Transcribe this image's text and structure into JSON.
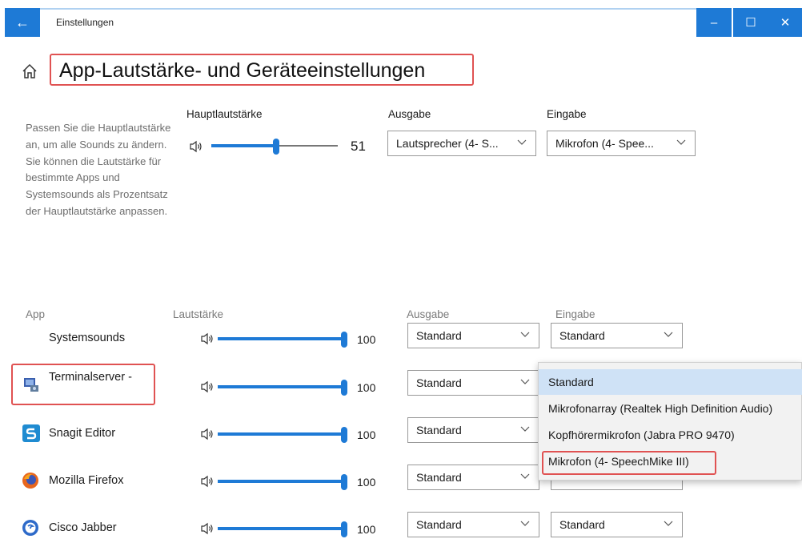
{
  "window": {
    "title": "Einstellungen",
    "back_glyph": "←",
    "minimize_glyph": "–",
    "maximize_glyph": "☐",
    "close_glyph": "✕",
    "accent": "#1e7ad6"
  },
  "page": {
    "title": "App-Lautstärke- und Geräteeinstellungen",
    "description": "Passen Sie die Hauptlautstärke an, um alle Sounds zu ändern. Sie können die Lautstärke für bestimmte Apps und Systemsounds als Prozentsatz der Hauptlautstärke anpassen."
  },
  "master": {
    "label": "Hauptlautstärke",
    "volume": 51,
    "output_label": "Ausgabe",
    "output_value": "Lautsprecher (4- S...",
    "input_label": "Eingabe",
    "input_value": "Mikrofon (4- Spee..."
  },
  "columns": {
    "app": "App",
    "volume": "Lautstärke",
    "output": "Ausgabe",
    "input": "Eingabe"
  },
  "apps": [
    {
      "name": "Systemsounds",
      "icon": "none",
      "volume": 100,
      "output": "Standard",
      "input": "Standard"
    },
    {
      "name": "Terminalserver -",
      "icon": "terminal-server-icon",
      "volume": 100,
      "output": "Standard",
      "input": ""
    },
    {
      "name": "Snagit Editor",
      "icon": "snagit-icon",
      "volume": 100,
      "output": "Standard",
      "input": ""
    },
    {
      "name": "Mozilla Firefox",
      "icon": "firefox-icon",
      "volume": 100,
      "output": "Standard",
      "input": ""
    },
    {
      "name": "Cisco Jabber",
      "icon": "jabber-icon",
      "volume": 100,
      "output": "Standard",
      "input": "Standard"
    }
  ],
  "input_dropdown_open": {
    "options": [
      "Standard",
      "Mikrofonarray (Realtek High Definition Audio)",
      "Kopfhörermikrofon (Jabra PRO 9470)",
      "Mikrofon (4- SpeechMike III)"
    ],
    "selected_index": 0,
    "highlighted_index": 3
  },
  "colors": {
    "accent": "#1e7ad6",
    "highlight_box": "#e05252",
    "selected_option": "#cfe2f6"
  }
}
